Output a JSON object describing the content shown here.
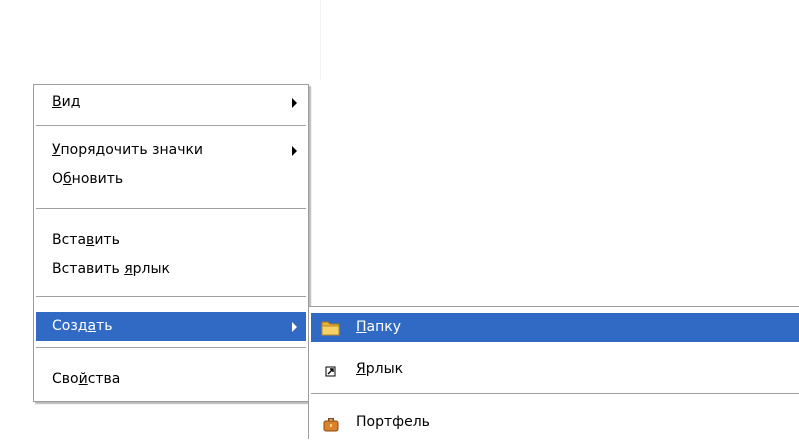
{
  "context_menu": {
    "items": [
      {
        "pre": "",
        "key": "В",
        "post": "ид"
      },
      {
        "pre": "",
        "key": "У",
        "post": "порядочить значки"
      },
      {
        "pre": "О",
        "key": "б",
        "post": "новить"
      },
      {
        "pre": "Вста",
        "key": "в",
        "post": "ить"
      },
      {
        "pre": "Вставить ",
        "key": "я",
        "post": "рлык"
      },
      {
        "pre": "Созд",
        "key": "а",
        "post": "ть"
      },
      {
        "pre": "Сво",
        "key": "й",
        "post": "ства"
      }
    ]
  },
  "submenu_create": {
    "items": [
      {
        "pre": "",
        "key": "П",
        "post": "апку",
        "icon": "folder-icon"
      },
      {
        "pre": "",
        "key": "Я",
        "post": "рлык",
        "icon": "shortcut-icon"
      },
      {
        "pre": "",
        "key": "",
        "post": "Портфель",
        "icon": "briefcase-icon"
      }
    ]
  },
  "colors": {
    "highlight": "#316ac5",
    "highlight_text": "#ffffff",
    "menu_border": "#9d9d9d"
  }
}
